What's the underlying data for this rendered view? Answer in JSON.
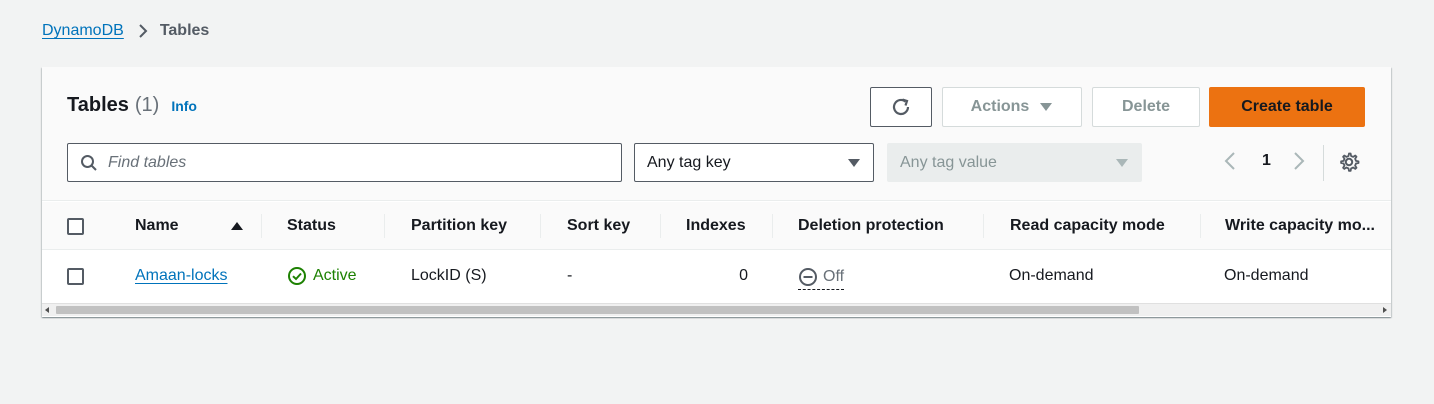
{
  "breadcrumb": {
    "root": "DynamoDB",
    "current": "Tables"
  },
  "panel": {
    "title": "Tables",
    "count": "(1)",
    "info": "Info"
  },
  "toolbar": {
    "refresh_icon": "refresh-icon",
    "actions_label": "Actions",
    "delete_label": "Delete",
    "create_label": "Create table"
  },
  "filters": {
    "search_placeholder": "Find tables",
    "tag_key_label": "Any tag key",
    "tag_value_label": "Any tag value"
  },
  "pagination": {
    "current_page": "1"
  },
  "table": {
    "columns": {
      "name": "Name",
      "status": "Status",
      "partition_key": "Partition key",
      "sort_key": "Sort key",
      "indexes": "Indexes",
      "deletion_protection": "Deletion protection",
      "read_capacity_mode": "Read capacity mode",
      "write_capacity_mode": "Write capacity mo..."
    },
    "rows": [
      {
        "name": "Amaan-locks",
        "status": "Active",
        "partition_key": "LockID (S)",
        "sort_key": "-",
        "indexes": "0",
        "deletion_protection": "Off",
        "read_capacity_mode": "On-demand",
        "write_capacity_mode": "On-demand"
      }
    ]
  },
  "colors": {
    "link": "#0073bb",
    "primary_button": "#ec7211",
    "active_status": "#1d8102"
  }
}
